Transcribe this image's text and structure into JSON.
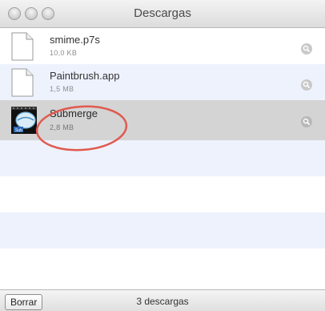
{
  "window": {
    "title": "Descargas"
  },
  "downloads": [
    {
      "name": "smime.p7s",
      "size": "10,0 KB",
      "icon": "document-icon",
      "reveal_icon": "magnifier-icon"
    },
    {
      "name": "Paintbrush.app",
      "size": "1,5 MB",
      "icon": "document-icon",
      "reveal_icon": "magnifier-icon"
    },
    {
      "name": "Submerge",
      "size": "2,8 MB",
      "icon": "submerge-app-icon",
      "reveal_icon": "magnifier-icon",
      "selected": true
    }
  ],
  "annotation": {
    "shape": "ellipse",
    "color": "#e05a4f"
  },
  "footer": {
    "clear_label": "Borrar",
    "status": "3 descargas"
  },
  "colors": {
    "row_alt": "#edf2fd",
    "row_selected": "#d4d4d4"
  }
}
